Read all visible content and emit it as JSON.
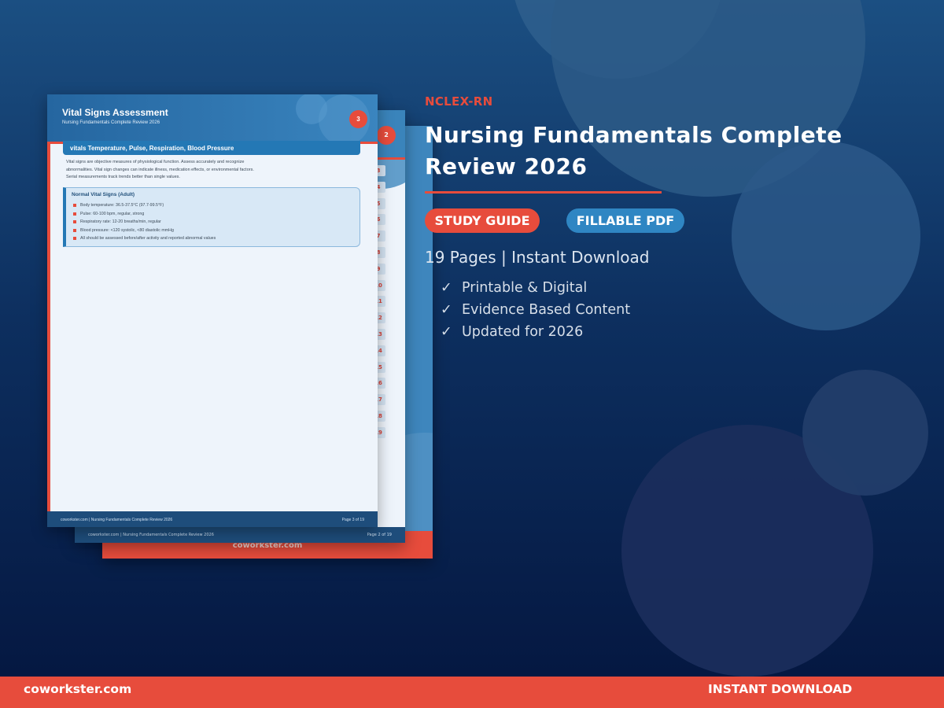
{
  "background": {
    "colors": {
      "top": "#1b4f82",
      "bottom": "#04163f",
      "accent": "#e74c3c",
      "blue": "#2f86c3"
    }
  },
  "preview": {
    "back_page": {
      "footer_label": "coworkster.com"
    },
    "middle_page": {
      "badge": "2",
      "toc_numbers": [
        "3",
        "4",
        "5",
        "6",
        "7",
        "8",
        "9",
        "10",
        "11",
        "12",
        "13",
        "14",
        "15",
        "16",
        "17",
        "18",
        "19"
      ],
      "footer_left": "coworkster.com  |  Nursing Fundamentals Complete Review 2026",
      "footer_right": "Page 2 of 19"
    },
    "front_page": {
      "title": "Vital Signs Assessment",
      "subtitle": "Nursing Fundamentals Complete Review 2026",
      "badge": "3",
      "section_title": "vitals  Temperature, Pulse, Respiration, Blood Pressure",
      "paragraph": "Vital signs are objective measures of physiological function. Assess accurately and recognize abnormalities. Vital sign changes can indicate illness, medication effects, or environmental factors. Serial measurements track trends better than single values.",
      "box_title": "Normal Vital Signs (Adult)",
      "box_items": [
        "Body temperature: 36.5-37.5°C (97.7-99.5°F)",
        "Pulse: 60-100 bpm, regular, strong",
        "Respiratory rate: 12-20 breaths/min, regular",
        "Blood pressure: <120 systolic, <80 diastolic mmHg",
        "All should be assessed before/after activity and reported abnormal values"
      ],
      "footer_left": "coworkster.com  |  Nursing Fundamentals Complete Review 2026",
      "footer_right": "Page 3 of 19"
    }
  },
  "info": {
    "category": "NCLEX-RN",
    "title": "Nursing Fundamentals Complete Review 2026",
    "tags": [
      "STUDY GUIDE",
      "FILLABLE PDF"
    ],
    "pages_line": "19 Pages | Instant Download",
    "check_icon": "check-icon",
    "features": [
      "Printable & Digital",
      "Evidence Based Content",
      "Updated for 2026"
    ]
  },
  "footer_bar": {
    "left": "coworkster.com",
    "right": "INSTANT DOWNLOAD"
  }
}
